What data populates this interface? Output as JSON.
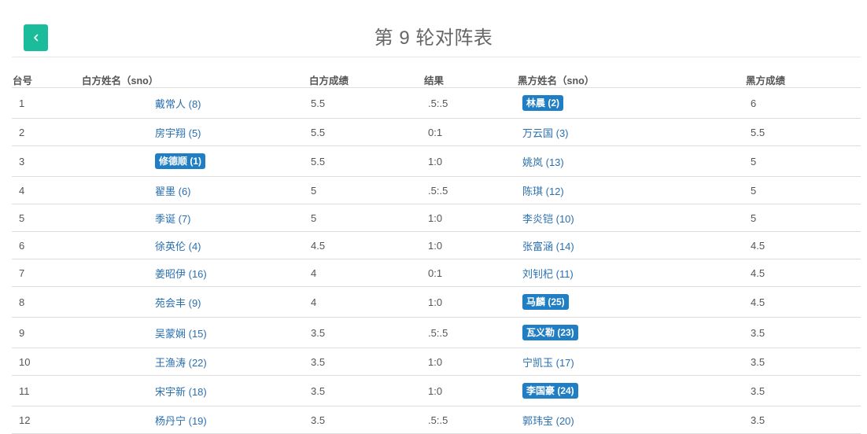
{
  "header": {
    "title": "第 9 轮对阵表",
    "back_icon": "chevron-left-icon"
  },
  "colors": {
    "back_button": "#1abc9c",
    "link": "#2a6fb0",
    "badge": "#1f7ec4"
  },
  "table": {
    "headers": {
      "board": "台号",
      "white_name": "白方姓名（sno）",
      "white_score": "白方成绩",
      "result": "结果",
      "black_name": "黑方姓名（sno）",
      "black_score": "黑方成绩"
    },
    "rows": [
      {
        "board": "1",
        "white": "戴常人 (8)",
        "white_hl": false,
        "wscore": "5.5",
        "result": ".5:.5",
        "black": "林晨 (2)",
        "black_hl": true,
        "bscore": "6"
      },
      {
        "board": "2",
        "white": "房宇翔 (5)",
        "white_hl": false,
        "wscore": "5.5",
        "result": "0:1",
        "black": "万云国 (3)",
        "black_hl": false,
        "bscore": "5.5"
      },
      {
        "board": "3",
        "white": "修德顺 (1)",
        "white_hl": true,
        "wscore": "5.5",
        "result": "1:0",
        "black": "姚岚 (13)",
        "black_hl": false,
        "bscore": "5"
      },
      {
        "board": "4",
        "white": "翟墨 (6)",
        "white_hl": false,
        "wscore": "5",
        "result": ".5:.5",
        "black": "陈琪 (12)",
        "black_hl": false,
        "bscore": "5"
      },
      {
        "board": "5",
        "white": "季诞 (7)",
        "white_hl": false,
        "wscore": "5",
        "result": "1:0",
        "black": "李炎铠 (10)",
        "black_hl": false,
        "bscore": "5"
      },
      {
        "board": "6",
        "white": "徐英伦 (4)",
        "white_hl": false,
        "wscore": "4.5",
        "result": "1:0",
        "black": "张富涵 (14)",
        "black_hl": false,
        "bscore": "4.5"
      },
      {
        "board": "7",
        "white": "姜昭伊 (16)",
        "white_hl": false,
        "wscore": "4",
        "result": "0:1",
        "black": "刘钊杞 (11)",
        "black_hl": false,
        "bscore": "4.5"
      },
      {
        "board": "8",
        "white": "苑会丰 (9)",
        "white_hl": false,
        "wscore": "4",
        "result": "1:0",
        "black": "马麟 (25)",
        "black_hl": true,
        "bscore": "4.5"
      },
      {
        "board": "9",
        "white": "吴蒙娴 (15)",
        "white_hl": false,
        "wscore": "3.5",
        "result": ".5:.5",
        "black": "瓦义勒 (23)",
        "black_hl": true,
        "bscore": "3.5"
      },
      {
        "board": "10",
        "white": "王渔涛 (22)",
        "white_hl": false,
        "wscore": "3.5",
        "result": "1:0",
        "black": "宁凯玉 (17)",
        "black_hl": false,
        "bscore": "3.5"
      },
      {
        "board": "11",
        "white": "宋宇新 (18)",
        "white_hl": false,
        "wscore": "3.5",
        "result": "1:0",
        "black": "李国豪 (24)",
        "black_hl": true,
        "bscore": "3.5"
      },
      {
        "board": "12",
        "white": "杨丹宁 (19)",
        "white_hl": false,
        "wscore": "3.5",
        "result": ".5:.5",
        "black": "郭玮宝 (20)",
        "black_hl": false,
        "bscore": "3.5"
      }
    ]
  }
}
